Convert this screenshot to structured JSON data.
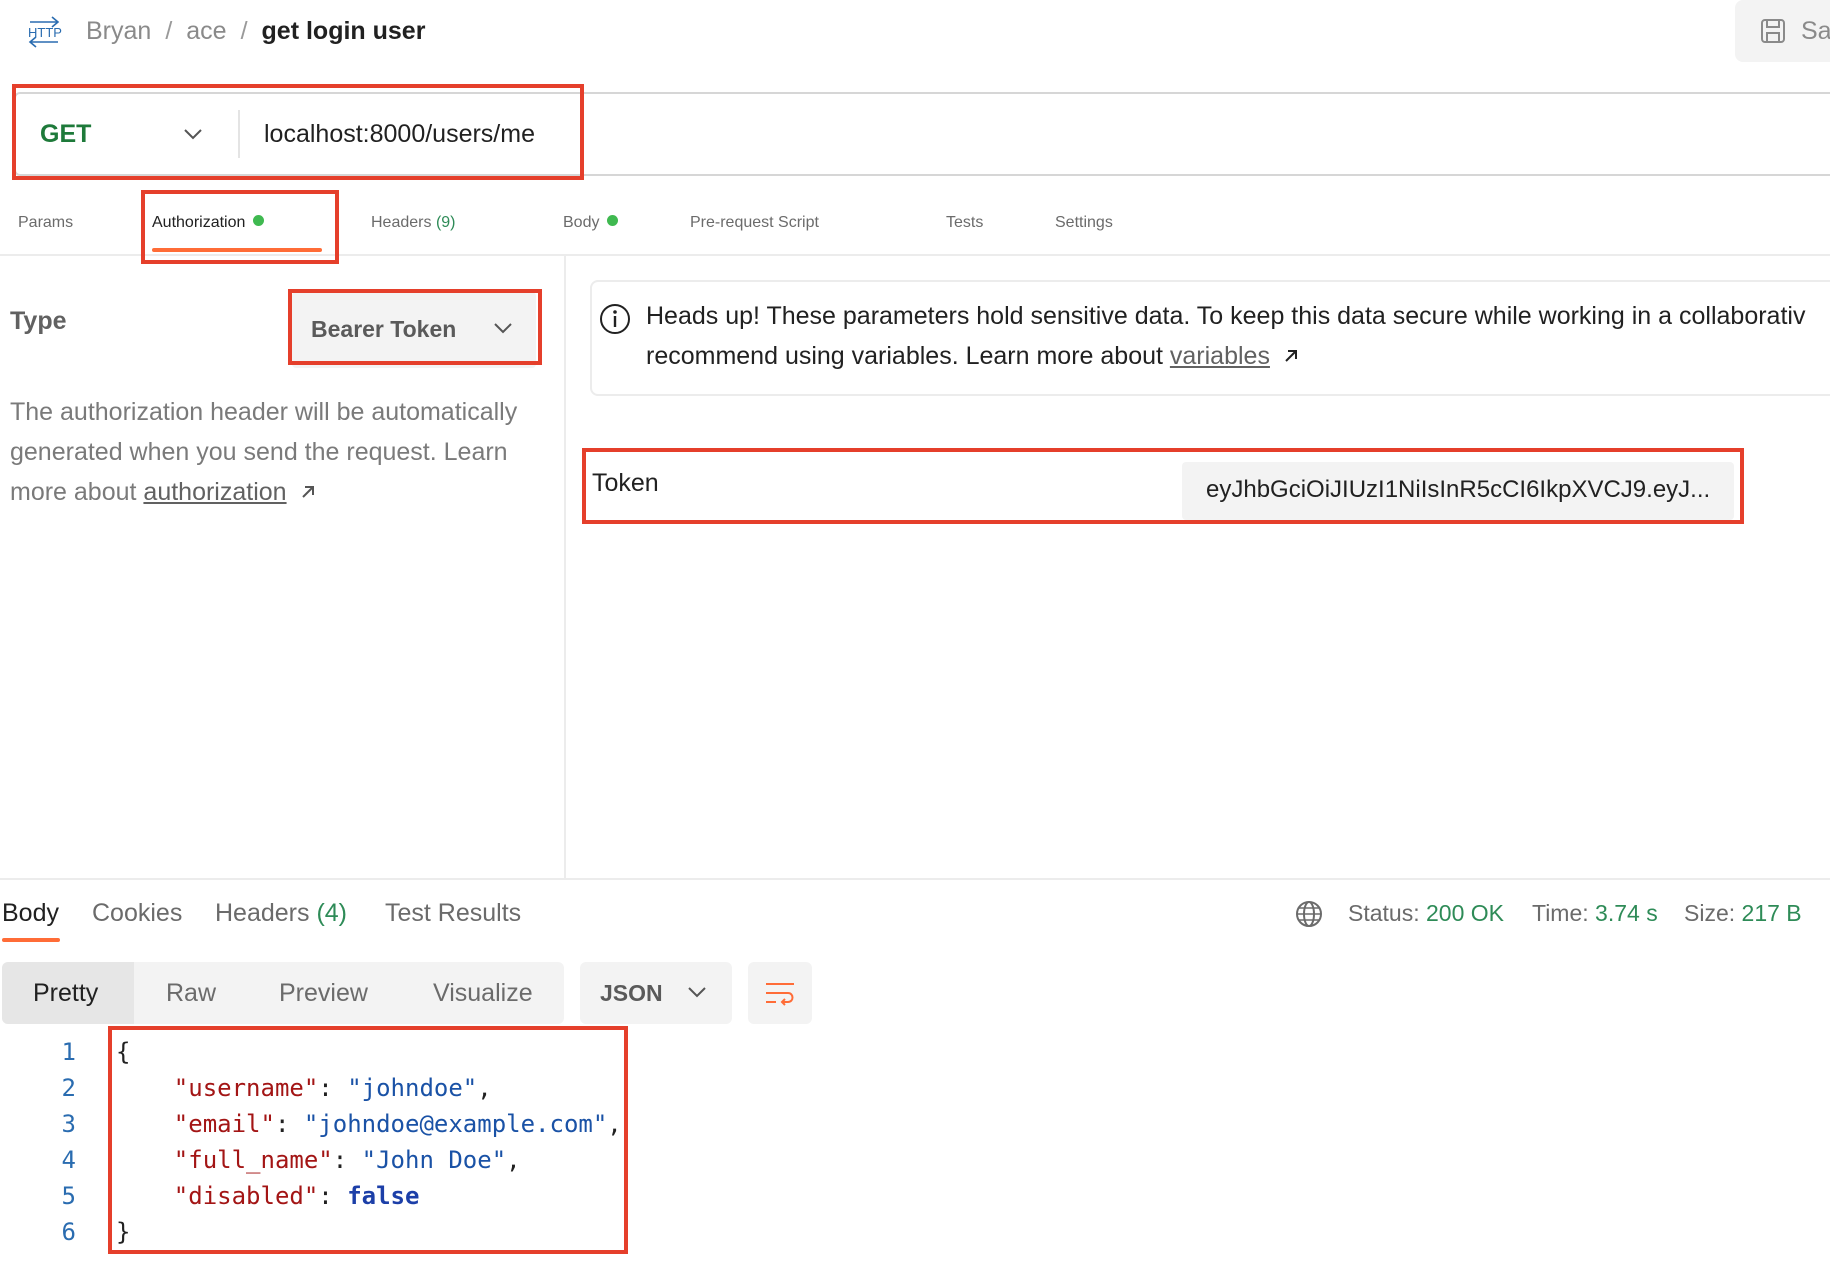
{
  "header": {
    "breadcrumb": [
      "Bryan",
      "ace"
    ],
    "separator": "/",
    "current": "get login user",
    "save_label": "Sa"
  },
  "request": {
    "method": "GET",
    "url": "localhost:8000/users/me"
  },
  "request_tabs": {
    "params": "Params",
    "authorization": "Authorization",
    "headers": "Headers",
    "headers_count": "(9)",
    "body": "Body",
    "pre_request": "Pre-request Script",
    "tests": "Tests",
    "settings": "Settings"
  },
  "auth": {
    "type_label": "Type",
    "type_value": "Bearer Token",
    "help_text": "The authorization header will be automatically generated when you send the request. Learn more about ",
    "help_link": "authorization",
    "notice_line1": "Heads up! These parameters hold sensitive data. To keep this data secure while working in a collaborativ",
    "notice_line2": "recommend using variables. Learn more about ",
    "notice_link": "variables",
    "token_label": "Token",
    "token_value": "eyJhbGciOiJIUzI1NiIsInR5cCI6IkpXVCJ9.eyJ..."
  },
  "response_tabs": {
    "body": "Body",
    "cookies": "Cookies",
    "headers": "Headers",
    "headers_count": "(4)",
    "test_results": "Test Results"
  },
  "status": {
    "status_label": "Status:",
    "status_value": "200 OK",
    "time_label": "Time:",
    "time_value": "3.74 s",
    "size_label": "Size:",
    "size_value": "217 B"
  },
  "format": {
    "pretty": "Pretty",
    "raw": "Raw",
    "preview": "Preview",
    "visualize": "Visualize",
    "type": "JSON"
  },
  "response_body": {
    "line_numbers": [
      "1",
      "2",
      "3",
      "4",
      "5",
      "6"
    ],
    "open_brace": "{",
    "close_brace": "}",
    "fields": [
      {
        "key": "\"username\"",
        "value": "\"johndoe\"",
        "trail": ","
      },
      {
        "key": "\"email\"",
        "value": "\"johndoe@example.com\"",
        "trail": ","
      },
      {
        "key": "\"full_name\"",
        "value": "\"John Doe\"",
        "trail": ","
      },
      {
        "key": "\"disabled\"",
        "value": "false",
        "trail": ""
      }
    ]
  },
  "colors": {
    "accent": "#ff6c37",
    "highlight": "#e53f2b",
    "method_get": "#1e7a3a",
    "status_ok": "#2e8b57"
  },
  "icons": [
    "http-icon",
    "chevron-down-icon",
    "info-icon",
    "external-link-icon",
    "globe-icon",
    "wrap-lines-icon",
    "save-icon"
  ]
}
